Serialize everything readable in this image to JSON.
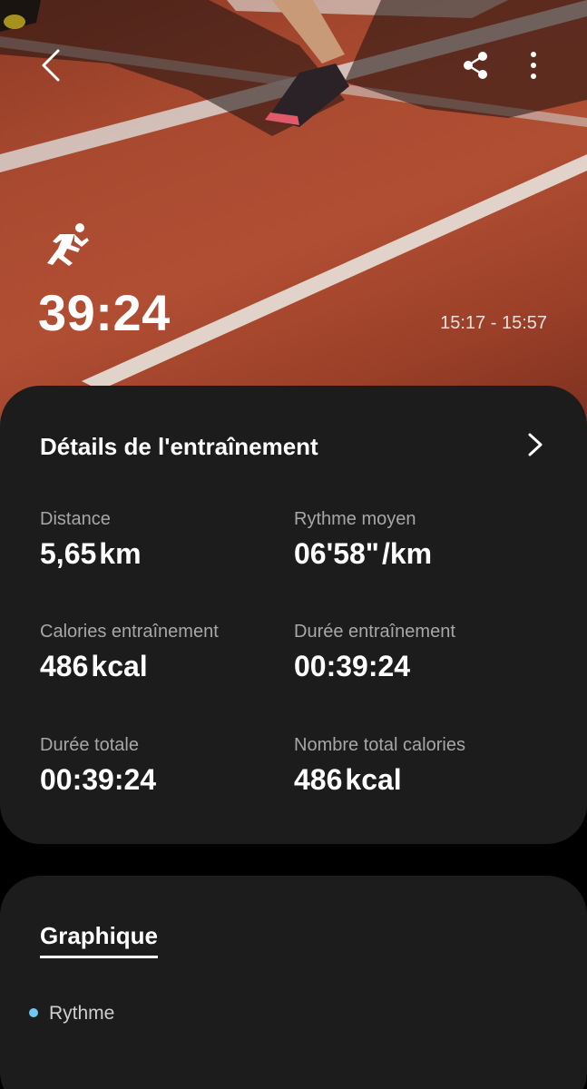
{
  "hero": {
    "activity_icon": "running-icon",
    "duration": "39:24",
    "time_range": "15:17 - 15:57"
  },
  "toolbar": {
    "back_icon": "back-arrow-icon",
    "share_icon": "share-icon",
    "more_icon": "more-vertical-icon"
  },
  "details": {
    "title": "Détails de l'entraînement",
    "stats": [
      {
        "label": "Distance",
        "value": "5,65",
        "unit": "km"
      },
      {
        "label": "Rythme moyen",
        "value": "06'58\"",
        "unit": "/km"
      },
      {
        "label": "Calories entraînement",
        "value": "486",
        "unit": "kcal"
      },
      {
        "label": "Durée entraînement",
        "value": "00:39:24",
        "unit": ""
      },
      {
        "label": "Durée totale",
        "value": "00:39:24",
        "unit": ""
      },
      {
        "label": "Nombre total calories",
        "value": "486",
        "unit": "kcal"
      }
    ]
  },
  "graph": {
    "tab_label": "Graphique",
    "legend_label": "Rythme",
    "legend_color": "#6ec9f1"
  }
}
